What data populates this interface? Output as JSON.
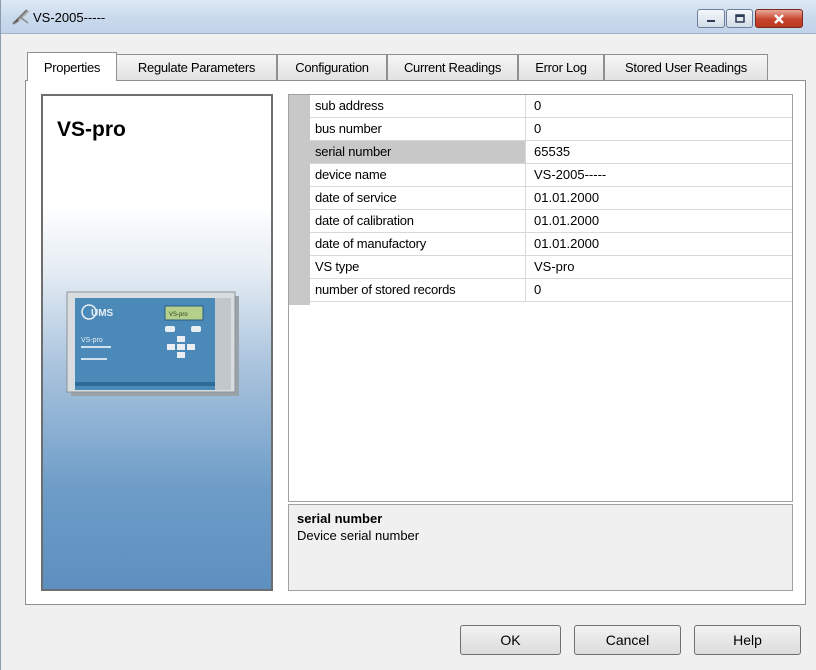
{
  "window": {
    "title": "VS-2005-----",
    "app_icon": "pencil-tool-icon",
    "controls": {
      "minimize": "minimize-icon",
      "maximize": "maximize-icon",
      "close": "close-icon"
    }
  },
  "tabs": [
    {
      "label": "Properties",
      "active": true
    },
    {
      "label": "Regulate Parameters",
      "active": false
    },
    {
      "label": "Configuration",
      "active": false
    },
    {
      "label": "Current Readings",
      "active": false
    },
    {
      "label": "Error Log",
      "active": false
    },
    {
      "label": "Stored User Readings",
      "active": false
    }
  ],
  "device": {
    "name": "VS-pro",
    "image_logo": "UMS",
    "image_screen_text": "VS-pro",
    "image_body_text": "VS-pro"
  },
  "properties": [
    {
      "name": "sub address",
      "value": "0"
    },
    {
      "name": "bus number",
      "value": "0"
    },
    {
      "name": "serial number",
      "value": "65535",
      "selected": true
    },
    {
      "name": "device name",
      "value": "VS-2005-----"
    },
    {
      "name": "date of service",
      "value": "01.01.2000"
    },
    {
      "name": "date of calibration",
      "value": "01.01.2000"
    },
    {
      "name": "date of manufactory",
      "value": "01.01.2000"
    },
    {
      "name": "VS type",
      "value": "VS-pro"
    },
    {
      "name": "number of stored records",
      "value": "0"
    }
  ],
  "description": {
    "title": "serial number",
    "text": "Device serial number"
  },
  "buttons": {
    "ok": "OK",
    "cancel": "Cancel",
    "help": "Help"
  },
  "colors": {
    "selected_row": "#c8c8c8",
    "device_panel_blue": "#5d8fc0",
    "close_button": "#c7452c"
  }
}
